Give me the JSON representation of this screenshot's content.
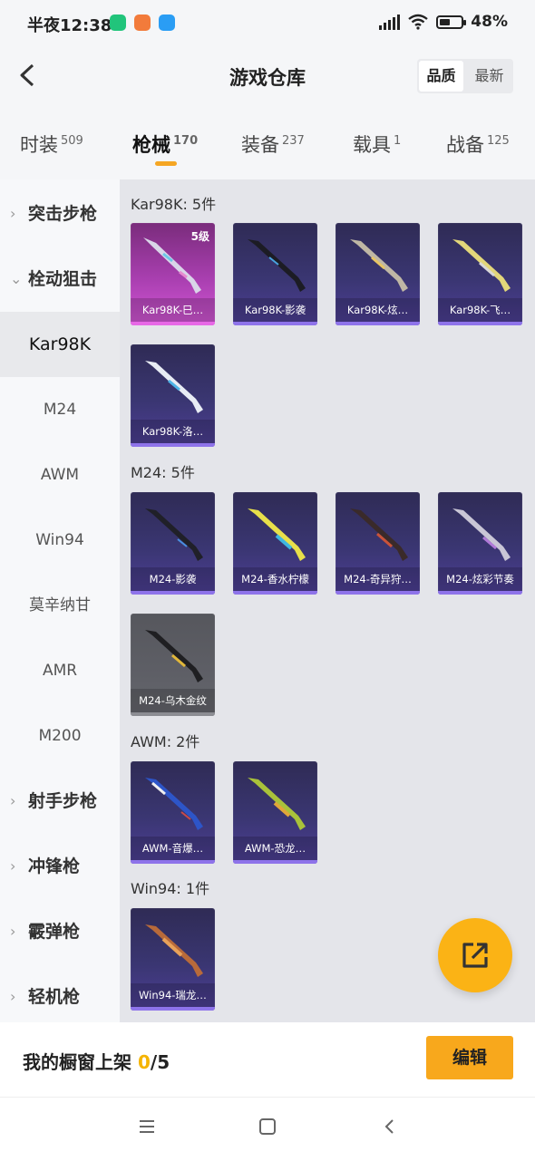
{
  "status": {
    "time": "半夜12:38",
    "battery": "48%",
    "icons": [
      "shield-app-icon",
      "shopping-app-icon",
      "chat-app-icon",
      "hd-signal-icon",
      "wifi-icon",
      "battery-icon"
    ]
  },
  "header": {
    "title": "游戏仓库",
    "sort_quality": "品质",
    "sort_latest": "最新"
  },
  "tabs": [
    {
      "label": "时装",
      "count": "509"
    },
    {
      "label": "枪械",
      "count": "170"
    },
    {
      "label": "装备",
      "count": "237"
    },
    {
      "label": "载具",
      "count": "1"
    },
    {
      "label": "战备",
      "count": "125"
    }
  ],
  "sidebar": {
    "categories": [
      {
        "label": "突击步枪"
      },
      {
        "label": "栓动狙击"
      },
      {
        "label": "射手步枪"
      },
      {
        "label": "冲锋枪"
      },
      {
        "label": "霰弹枪"
      },
      {
        "label": "轻机枪"
      }
    ],
    "subs": [
      "Kar98K",
      "M24",
      "AWM",
      "Win94",
      "莫辛纳甘",
      "AMR",
      "M200"
    ]
  },
  "groups": [
    {
      "title": "Kar98K: 5件",
      "items": [
        {
          "label": "Kar98K-巳…",
          "level": "5级"
        },
        {
          "label": "Kar98K-影袭"
        },
        {
          "label": "Kar98K-炫…"
        },
        {
          "label": "Kar98K-飞…"
        },
        {
          "label": "Kar98K-洛…"
        }
      ]
    },
    {
      "title": "M24: 5件",
      "items": [
        {
          "label": "M24-影袭"
        },
        {
          "label": "M24-香水柠檬"
        },
        {
          "label": "M24-奇异狩…"
        },
        {
          "label": "M24-炫彩节奏"
        },
        {
          "label": "M24-乌木金纹"
        }
      ]
    },
    {
      "title": "AWM: 2件",
      "items": [
        {
          "label": "AWM-音爆…"
        },
        {
          "label": "AWM-恐龙…"
        }
      ]
    },
    {
      "title": "Win94: 1件",
      "items": [
        {
          "label": "Win94-瑞龙…"
        }
      ]
    }
  ],
  "footer": {
    "showcase_label": "我的橱窗上架",
    "showcase_count": "0",
    "showcase_total": "/5",
    "edit_label": "编辑"
  },
  "colors": {
    "accent": "#f5a623",
    "card_epic": "#3a3672",
    "card_legend": "#a93fb0",
    "edit_button": "#f8a81c"
  }
}
